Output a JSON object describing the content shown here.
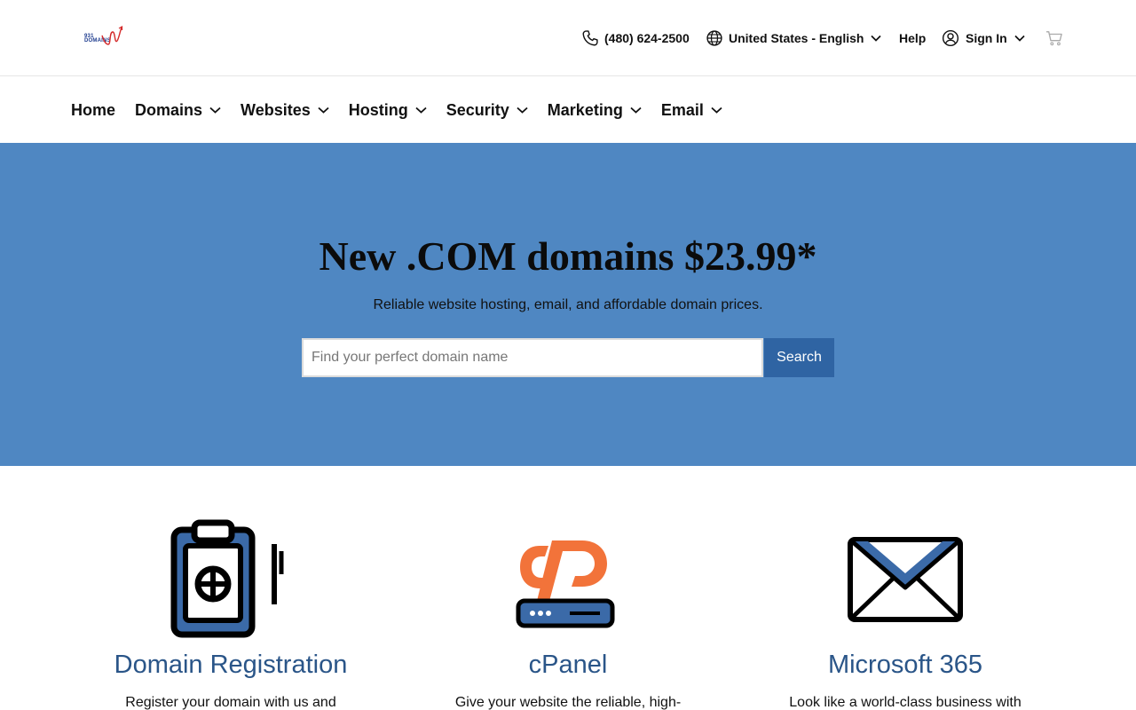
{
  "brand": {
    "logo_text_top": "931",
    "logo_text_bottom": "DOMAINS"
  },
  "utility": {
    "phone": "(480) 624-2500",
    "language": "United States - English",
    "help": "Help",
    "sign_in": "Sign In"
  },
  "nav": {
    "items": [
      {
        "label": "Home"
      },
      {
        "label": "Domains"
      },
      {
        "label": "Websites"
      },
      {
        "label": "Hosting"
      },
      {
        "label": "Security"
      },
      {
        "label": "Marketing"
      },
      {
        "label": "Email"
      }
    ]
  },
  "hero": {
    "title": "New .COM domains $23.99*",
    "subtitle": "Reliable website hosting, email, and affordable domain prices.",
    "search_placeholder": "Find your perfect domain name",
    "search_value": "",
    "search_button": "Search"
  },
  "features": [
    {
      "title": "Domain Registration",
      "text": "Register your domain with us and"
    },
    {
      "title": "cPanel",
      "text": "Give your website the reliable, high-"
    },
    {
      "title": "Microsoft 365",
      "text": "Look like a world-class business with"
    }
  ],
  "colors": {
    "hero_bg": "#4f87c2",
    "search_button": "#2f64a3",
    "feature_title": "#2a5588",
    "cpanel_orange": "#f2733a",
    "icon_blue": "#3b6aa8"
  },
  "icons": {
    "phone": "phone-icon",
    "globe": "globe-icon",
    "user": "user-icon",
    "cart": "cart-icon",
    "chevron": "chevron-down-icon"
  }
}
